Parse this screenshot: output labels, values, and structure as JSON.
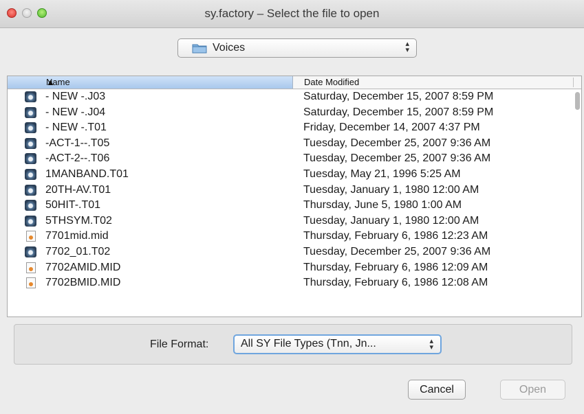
{
  "window": {
    "title": "sy.factory – Select the file to open"
  },
  "location": {
    "folder": "Voices",
    "folder_icon": "folder-icon"
  },
  "browser": {
    "columns": {
      "name": "Name",
      "date": "Date Modified"
    },
    "rows": [
      {
        "name": "- NEW -.J03",
        "date": "Saturday, December 15, 2007 8:59 PM",
        "icon": "disk"
      },
      {
        "name": "- NEW -.J04",
        "date": "Saturday, December 15, 2007 8:59 PM",
        "icon": "disk"
      },
      {
        "name": "- NEW -.T01",
        "date": "Friday, December 14, 2007 4:37 PM",
        "icon": "disk"
      },
      {
        "name": "-ACT-1--.T05",
        "date": "Tuesday, December 25, 2007 9:36 AM",
        "icon": "disk"
      },
      {
        "name": "-ACT-2--.T06",
        "date": "Tuesday, December 25, 2007 9:36 AM",
        "icon": "disk"
      },
      {
        "name": "1MANBAND.T01",
        "date": "Tuesday, May 21, 1996 5:25 AM",
        "icon": "disk"
      },
      {
        "name": "20TH-AV.T01",
        "date": "Tuesday, January 1, 1980 12:00 AM",
        "icon": "disk"
      },
      {
        "name": "50HIT-.T01",
        "date": "Thursday, June 5, 1980 1:00 AM",
        "icon": "disk"
      },
      {
        "name": "5THSYM.T02",
        "date": "Tuesday, January 1, 1980 12:00 AM",
        "icon": "disk"
      },
      {
        "name": "7701mid.mid",
        "date": "Thursday, February 6, 1986 12:23 AM",
        "icon": "doc"
      },
      {
        "name": "7702_01.T02",
        "date": "Tuesday, December 25, 2007 9:36 AM",
        "icon": "disk"
      },
      {
        "name": "7702AMID.MID",
        "date": "Thursday, February 6, 1986 12:09 AM",
        "icon": "doc"
      },
      {
        "name": "7702BMID.MID",
        "date": "Thursday, February 6, 1986 12:08 AM",
        "icon": "doc"
      }
    ]
  },
  "format": {
    "label": "File Format:",
    "value": "All SY File Types (Tnn, Jn...",
    "stepper_glyph": "⇕"
  },
  "buttons": {
    "cancel": "Cancel",
    "open": "Open"
  },
  "colors": {
    "selected_header": "#b7d0f0",
    "focus_ring": "#6fa5de"
  }
}
